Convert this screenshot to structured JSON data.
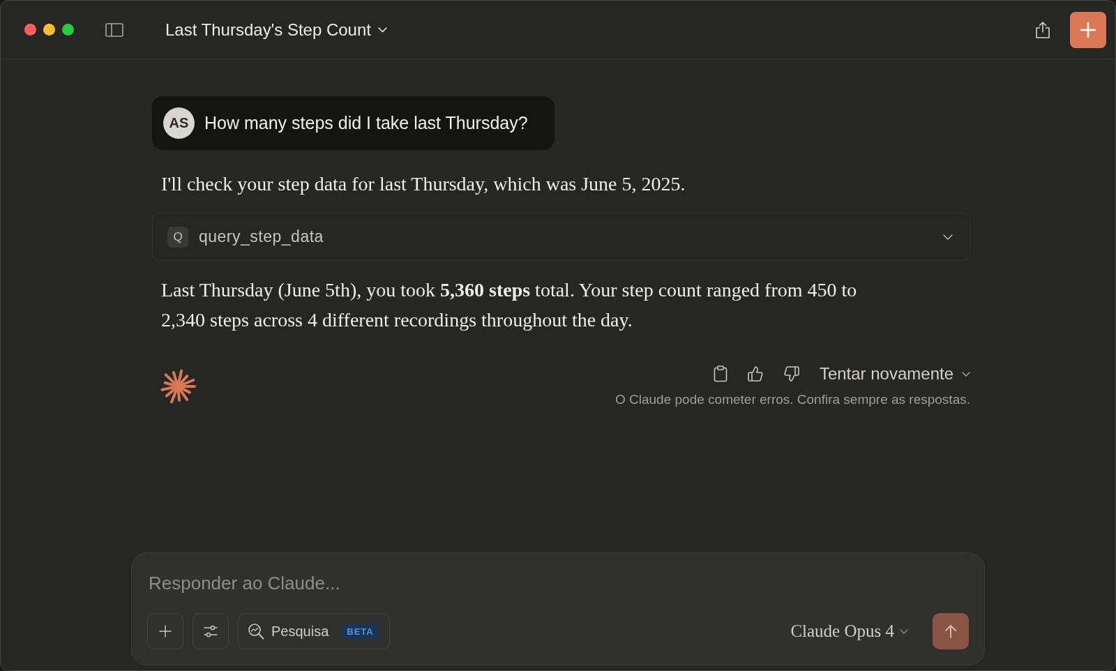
{
  "header": {
    "title": "Last Thursday's Step Count"
  },
  "conversation": [
    {
      "kind": "user",
      "avatar": "AS",
      "text": "How many steps did I take last Thursday?"
    },
    {
      "kind": "assistant_text",
      "text": "I'll check your step data for last Thursday, which was June 5, 2025."
    },
    {
      "kind": "tool_call",
      "initial": "Q",
      "name": "query_step_data",
      "expanded": false
    },
    {
      "kind": "assistant_text",
      "text": "Last Thursday (June 5th), you took **5,360 steps** total. Your step count ranged from 450 to 2,340 steps across 4 different recordings throughout the day."
    }
  ],
  "response_footer": {
    "retry_label": "Tentar novamente",
    "disclaimer": "O Claude pode cometer erros. Confira sempre as respostas."
  },
  "composer": {
    "placeholder": "Responder ao Claude...",
    "search_button": {
      "label": "Pesquisa",
      "badge": "BETA"
    },
    "model": "Claude Opus 4",
    "send_button": {
      "disabled": true
    }
  }
}
